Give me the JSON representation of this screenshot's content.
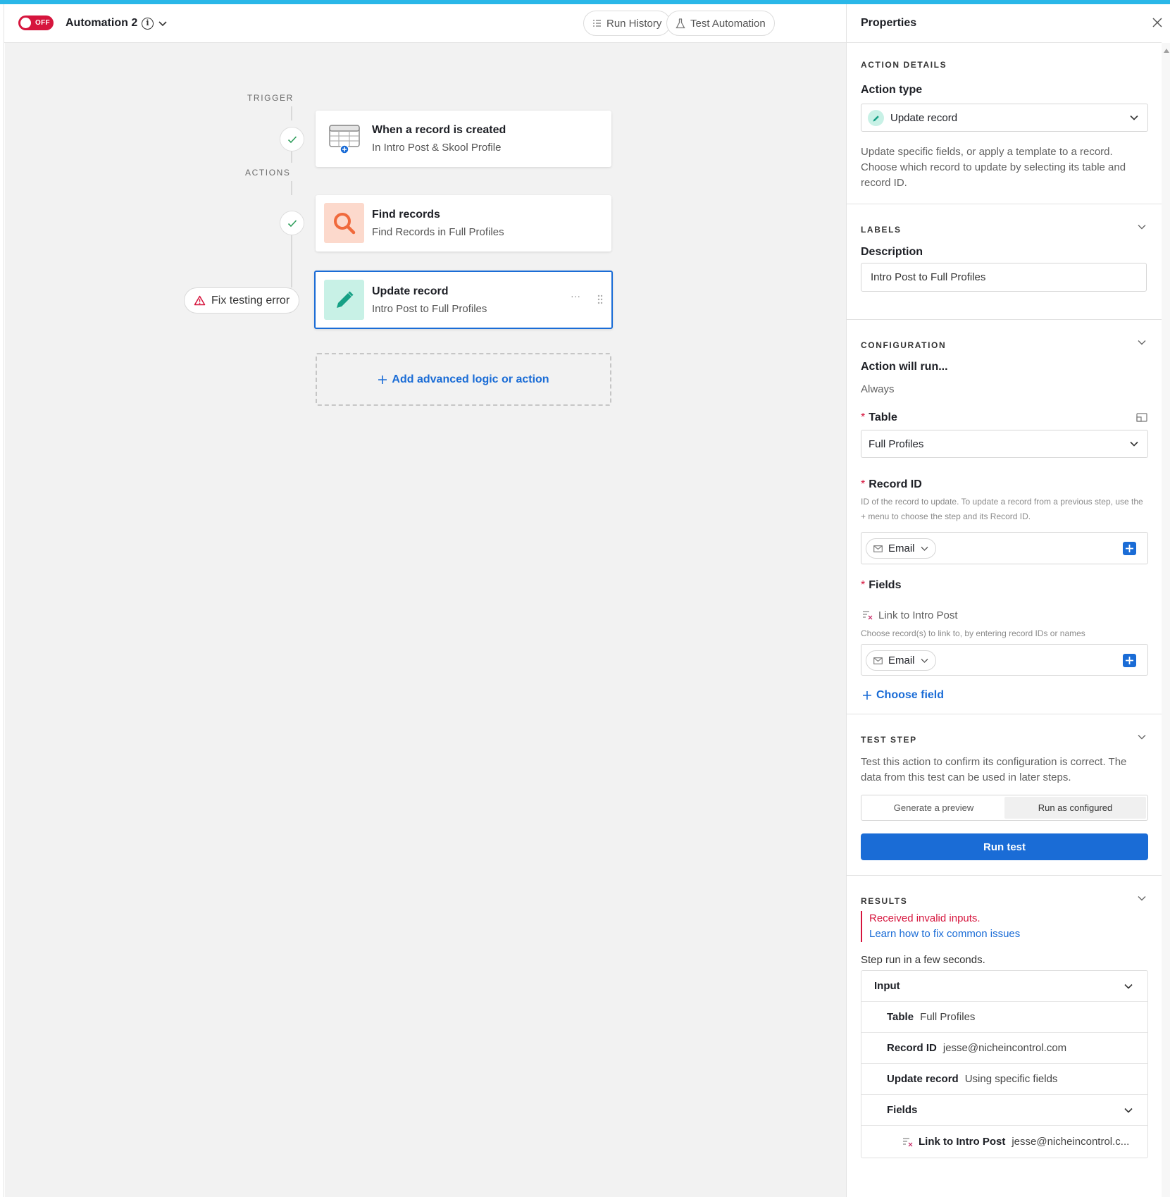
{
  "header": {
    "toggle_label": "OFF",
    "automation_name": "Automation 2",
    "run_history": "Run History",
    "test_automation": "Test Automation"
  },
  "flow": {
    "trigger_label": "TRIGGER",
    "actions_label": "ACTIONS",
    "trigger_card": {
      "title": "When a record is created",
      "subtitle": "In Intro Post & Skool Profile"
    },
    "find_card": {
      "title": "Find records",
      "subtitle": "Find Records in Full Profiles"
    },
    "update_card": {
      "title": "Update record",
      "subtitle": "Intro Post to Full Profiles",
      "more": "···"
    },
    "fix_error": "Fix testing error",
    "add_action": "Add advanced logic or action"
  },
  "panel": {
    "title": "Properties",
    "action_details": {
      "section": "ACTION DETAILS",
      "action_type_label": "Action type",
      "action_type_value": "Update record",
      "description": "Update specific fields, or apply a template to a record. Choose which record to update by selecting its table and record ID."
    },
    "labels": {
      "section": "LABELS",
      "description_label": "Description",
      "description_value": "Intro Post to Full Profiles"
    },
    "configuration": {
      "section": "CONFIGURATION",
      "run_label": "Action will run...",
      "run_value": "Always",
      "table_label": "Table",
      "table_value": "Full Profiles",
      "record_id_label": "Record ID",
      "record_id_help": "ID of the record to update. To update a record from a previous step, use the + menu to choose the step and its Record ID.",
      "record_id_token": "Email",
      "fields_label": "Fields",
      "field_name": "Link to Intro Post",
      "field_help": "Choose record(s) to link to, by entering record IDs or names",
      "field_token": "Email",
      "choose_field": "Choose field"
    },
    "test_step": {
      "section": "TEST STEP",
      "description": "Test this action to confirm its configuration is correct. The data from this test can be used in later steps.",
      "option_preview": "Generate a preview",
      "option_run": "Run as configured",
      "run_button": "Run test"
    },
    "results": {
      "section": "RESULTS",
      "error": "Received invalid inputs.",
      "help_link": "Learn how to fix common issues",
      "status": "Step run in a few seconds.",
      "input_label": "Input",
      "rows": [
        {
          "key": "Table",
          "value": "Full Profiles"
        },
        {
          "key": "Record ID",
          "value": "jesse@nicheincontrol.com"
        },
        {
          "key": "Update record",
          "value": "Using specific fields"
        }
      ],
      "fields_label": "Fields",
      "field_row": {
        "key": "Link to Intro Post",
        "value": "jesse@nicheincontrol.c..."
      }
    }
  },
  "colors": {
    "accent": "#1a6cd6",
    "danger": "#d6153d",
    "top_stripe": "#2ab7e8",
    "find_icon_bg": "#fcd9cc",
    "update_icon_bg": "#c8f1e6"
  }
}
